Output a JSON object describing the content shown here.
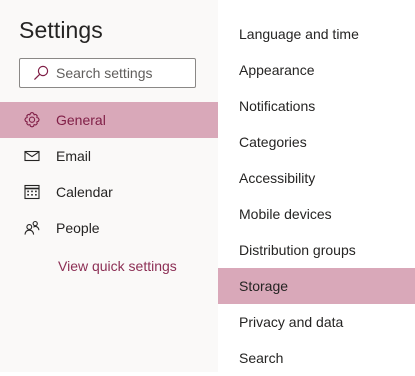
{
  "settings": {
    "title": "Settings",
    "search": {
      "placeholder": "Search settings"
    },
    "nav": [
      {
        "label": "General",
        "icon": "gear-icon",
        "selected": true
      },
      {
        "label": "Email",
        "icon": "mail-icon",
        "selected": false
      },
      {
        "label": "Calendar",
        "icon": "calendar-icon",
        "selected": false
      },
      {
        "label": "People",
        "icon": "people-icon",
        "selected": false
      }
    ],
    "quick_settings_link": "View quick settings"
  },
  "general": {
    "items": [
      {
        "label": "Language and time",
        "selected": false
      },
      {
        "label": "Appearance",
        "selected": false
      },
      {
        "label": "Notifications",
        "selected": false
      },
      {
        "label": "Categories",
        "selected": false
      },
      {
        "label": "Accessibility",
        "selected": false
      },
      {
        "label": "Mobile devices",
        "selected": false
      },
      {
        "label": "Distribution groups",
        "selected": false
      },
      {
        "label": "Storage",
        "selected": true
      },
      {
        "label": "Privacy and data",
        "selected": false
      },
      {
        "label": "Search",
        "selected": false
      }
    ]
  },
  "colors": {
    "selected_background": "#d9a8b9",
    "selected_text": "#801f47",
    "link": "#8c2f55",
    "pane_background": "#faf9f8"
  }
}
